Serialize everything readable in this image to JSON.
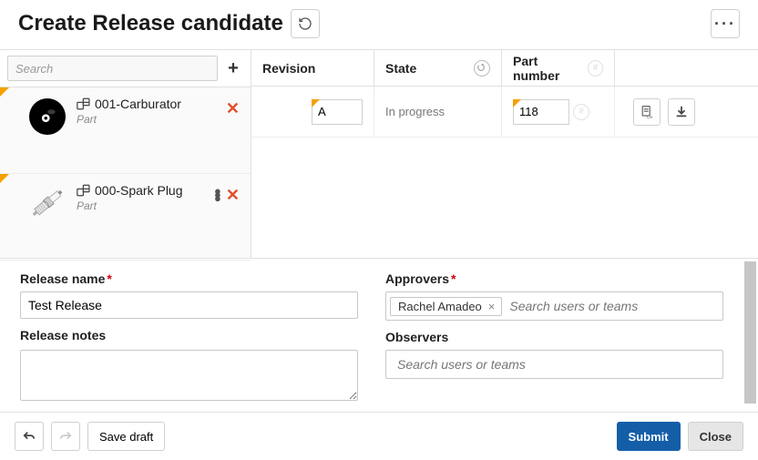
{
  "header": {
    "title": "Create Release candidate"
  },
  "sidebar": {
    "search_placeholder": "Search",
    "items": [
      {
        "name": "001-Carburator",
        "type": "Part"
      },
      {
        "name": "000-Spark Plug",
        "type": "Part"
      }
    ]
  },
  "table": {
    "headers": {
      "revision": "Revision",
      "state": "State",
      "part_number": "Part number"
    },
    "row": {
      "revision": "A",
      "state": "In progress",
      "part_number": "118"
    }
  },
  "form": {
    "release_name_label": "Release name",
    "release_name_value": "Test Release",
    "release_notes_label": "Release notes",
    "release_notes_value": "",
    "approvers_label": "Approvers",
    "approvers_tags": [
      "Rachel Amadeo"
    ],
    "observers_label": "Observers",
    "user_search_placeholder": "Search users or teams"
  },
  "footer": {
    "save_draft": "Save draft",
    "submit": "Submit",
    "close": "Close"
  }
}
